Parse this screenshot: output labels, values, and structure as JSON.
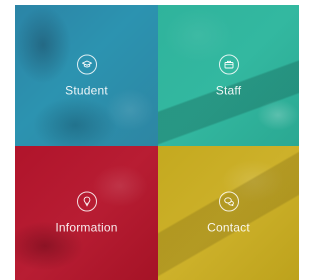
{
  "tiles": [
    {
      "label": "Student",
      "icon": "graduation-cap-icon",
      "color": "#2b8bab"
    },
    {
      "label": "Staff",
      "icon": "briefcase-icon",
      "color": "#31b49d"
    },
    {
      "label": "Information",
      "icon": "lightbulb-icon",
      "color": "#b3182e"
    },
    {
      "label": "Contact",
      "icon": "chat-icon",
      "color": "#c8ac24"
    }
  ]
}
